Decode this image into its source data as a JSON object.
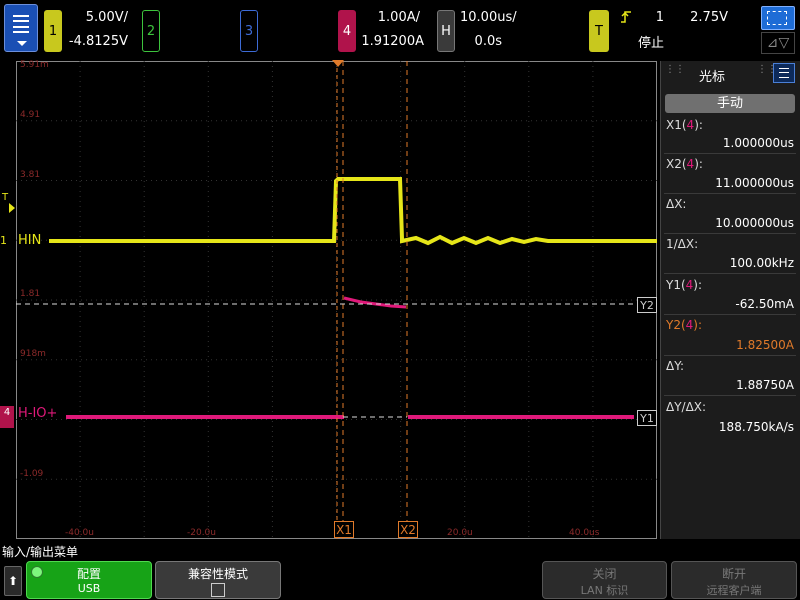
{
  "topbar": {
    "ch1": {
      "label": "1",
      "scale": "5.00V/",
      "offset": "-4.8125V"
    },
    "ch2": {
      "label": "2"
    },
    "ch3": {
      "label": "3"
    },
    "ch4": {
      "label": "4",
      "scale": "1.00A/",
      "offset": "1.91200A"
    },
    "horizontal": {
      "label": "H",
      "scale": "10.00us/",
      "delay": "0.0s"
    },
    "trigger": {
      "label": "T",
      "source": "1",
      "level": "2.75V",
      "status": "停止"
    }
  },
  "screen": {
    "volt_labels": [
      "5.91m",
      "4.91",
      "3.81",
      "1.81",
      "918m",
      "-1.09"
    ],
    "time_labels": [
      "-40.0u",
      "-20.0u",
      "20.0u",
      "40.0us"
    ],
    "ch1_tag": "1",
    "ch1_name": "HIN",
    "ch4_tag": "4",
    "ch4_name": "H-IO+",
    "trigger_marker": "T",
    "x1_tag": "X1",
    "x2_tag": "X2",
    "y1_tag": "Y1",
    "y2_tag": "Y2"
  },
  "sidebar": {
    "title": "光标",
    "mode_button": "手动",
    "x1_label": "X1(4):",
    "x1_value": "1.000000us",
    "x2_label": "X2(4):",
    "x2_value": "11.000000us",
    "dx_label": "ΔX:",
    "dx_value": "10.000000us",
    "inv_dx_label": "1/ΔX:",
    "inv_dx_value": "100.00kHz",
    "y1_label": "Y1(4):",
    "y1_value": "-62.50mA",
    "y2_label": "Y2(4):",
    "y2_value": "1.82500A",
    "dy_label": "ΔY:",
    "dy_value": "1.88750A",
    "dydx_label": "ΔY/ΔX:",
    "dydx_value": "188.750kA/s"
  },
  "bottom": {
    "menu_title": "输入/输出菜单",
    "config": {
      "line1": "配置",
      "line2": "USB"
    },
    "compat": {
      "line1": "兼容性模式"
    },
    "lan": {
      "line1": "关闭",
      "line2": "LAN 标识"
    },
    "remote": {
      "line1": "断开",
      "line2": "远程客户端"
    }
  },
  "colors": {
    "ch1": "#e6e619",
    "ch4": "#e0197a",
    "cursor": "#e07a2a",
    "accent": "#1e6cd6"
  }
}
